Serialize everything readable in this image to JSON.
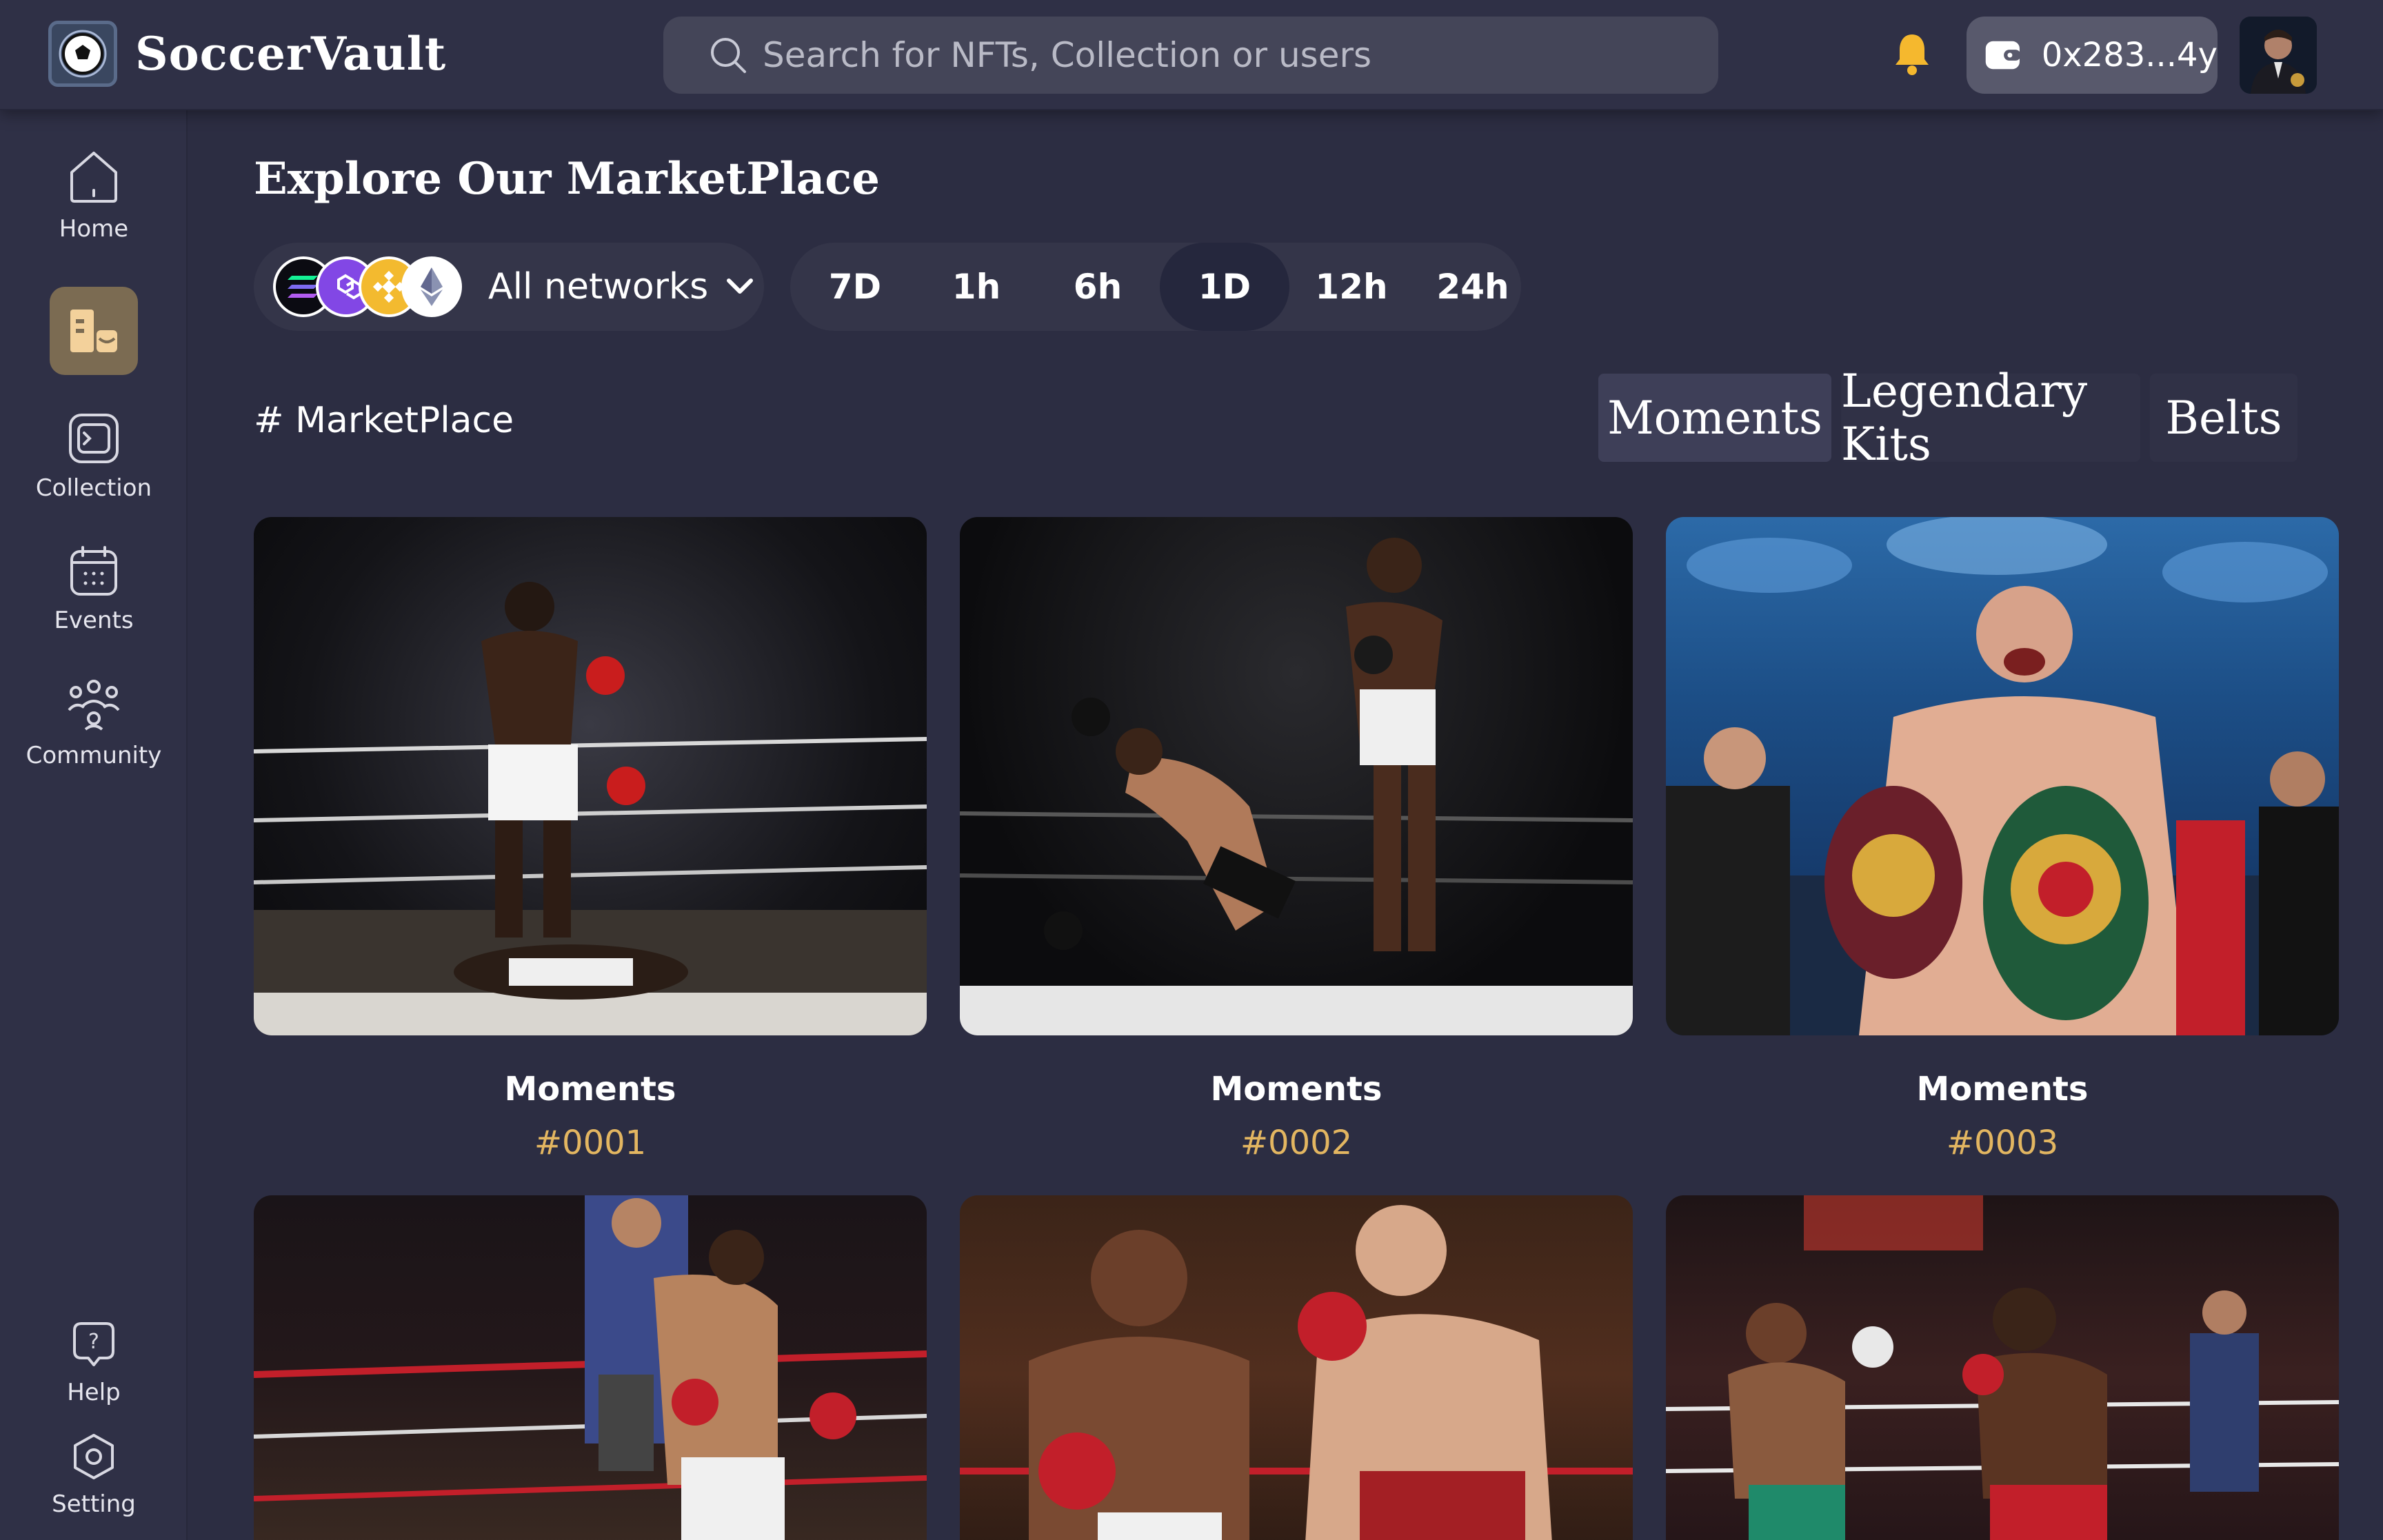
{
  "brand": {
    "name": "SoccerVault"
  },
  "search": {
    "placeholder": "Search for NFTs, Collection or users"
  },
  "wallet": {
    "address": "0x283...4y"
  },
  "sidebar": {
    "items": [
      {
        "label": "Home",
        "icon": "home-icon"
      },
      {
        "label": "",
        "icon": "marketplace-icon",
        "active": true
      },
      {
        "label": "Collection",
        "icon": "collection-icon"
      },
      {
        "label": "Events",
        "icon": "calendar-icon"
      },
      {
        "label": "Community",
        "icon": "community-icon"
      }
    ],
    "bottom": [
      {
        "label": "Help",
        "icon": "help-icon"
      },
      {
        "label": "Setting",
        "icon": "settings-icon"
      }
    ]
  },
  "main": {
    "title": "Explore Our MarketPlace",
    "network_filter": {
      "label": "All networks",
      "coins": [
        "solana",
        "polygon",
        "bnb",
        "ethereum"
      ]
    },
    "time_filters": [
      {
        "label": "7D",
        "active": false
      },
      {
        "label": "1h",
        "active": false
      },
      {
        "label": "6h",
        "active": false
      },
      {
        "label": "1D",
        "active": true
      },
      {
        "label": "12h",
        "active": false
      },
      {
        "label": "24h",
        "active": false
      }
    ],
    "section_label": "# MarketPlace",
    "tabs": [
      {
        "label": "Moments",
        "active": true
      },
      {
        "label": "Legendary Kits",
        "active": false
      },
      {
        "label": "Belts",
        "active": false
      }
    ],
    "cards": [
      {
        "title": "Moments",
        "id": "#0001"
      },
      {
        "title": "Moments",
        "id": "#0002"
      },
      {
        "title": "Moments",
        "id": "#0003"
      },
      {
        "title": "",
        "id": ""
      },
      {
        "title": "",
        "id": ""
      },
      {
        "title": "",
        "id": ""
      }
    ]
  },
  "colors": {
    "background": "#2c2d42",
    "accent_gold": "#e3b661",
    "active_nav": "#7b6b52",
    "bell": "#f5b82e"
  }
}
